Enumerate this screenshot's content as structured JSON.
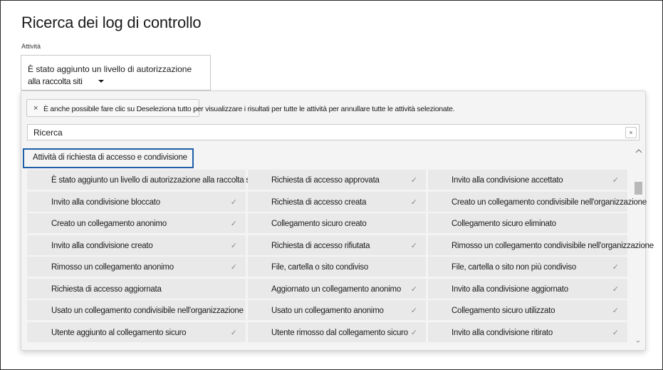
{
  "header": {
    "title": "Ricerca dei log di controllo",
    "activities_label": "Attività"
  },
  "activity_select": {
    "value_line1": "È stato aggiunto un livello di autorizzazione",
    "value_line2": "alla raccolta siti"
  },
  "dropdown": {
    "info_close": "×",
    "info_text": "È anche possibile fare clic su Deseleziona tutto per visualizzare i risultati per tutte le attività per annullare tutte le attività selezionate.",
    "search_placeholder": "Ricerca",
    "search_value": "",
    "search_clear": "×",
    "group_title": "Attività di richiesta di accesso e condivisione",
    "check_glyph": "✓",
    "rows": [
      [
        "È stato aggiunto un livello di autorizzazione alla raccolta siti",
        "Richiesta di accesso approvata",
        "Invito alla condivisione accettato"
      ],
      [
        "Invito alla condivisione bloccato",
        "Richiesta di accesso creata",
        "Creato un collegamento condivisibile nell'organizzazione"
      ],
      [
        "Creato un collegamento anonimo",
        "Collegamento sicuro creato",
        "Collegamento sicuro eliminato"
      ],
      [
        "Invito alla condivisione creato",
        "Richiesta di accesso rifiutata",
        "Rimosso un collegamento condivisibile nell'organizzazione"
      ],
      [
        "Rimosso un collegamento anonimo",
        "File, cartella o sito condiviso",
        "File, cartella o sito non più condiviso"
      ],
      [
        "Richiesta di accesso aggiornata",
        "Aggiornato un collegamento anonimo",
        "Invito alla condivisione aggiornato"
      ],
      [
        "Usato un collegamento condivisibile nell'organizzazione",
        "Usato un collegamento anonimo",
        "Collegamento sicuro utilizzato"
      ],
      [
        "Utente aggiunto al collegamento sicuro",
        "Utente rimosso dal collegamento sicuro",
        "Invito alla condivisione ritirato"
      ]
    ],
    "checks": [
      [
        false,
        true,
        true
      ],
      [
        true,
        true,
        false
      ],
      [
        true,
        false,
        false
      ],
      [
        true,
        true,
        false
      ],
      [
        true,
        false,
        true
      ],
      [
        false,
        true,
        true
      ],
      [
        false,
        true,
        true
      ],
      [
        true,
        true,
        true
      ]
    ]
  },
  "icons": [
    "close-icon",
    "chevron-down-icon",
    "checkmark-icon",
    "scroll-up-icon",
    "scroll-down-icon"
  ],
  "colors": {
    "focus_border": "#1f5fa8",
    "panel_bg": "#f4f4f4",
    "cell_bg": "#e9e9e9",
    "check": "#8a8a8a"
  }
}
